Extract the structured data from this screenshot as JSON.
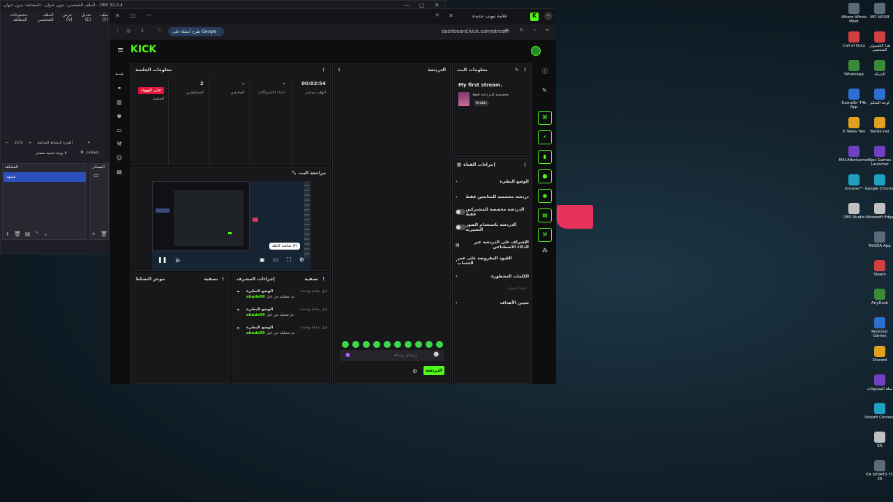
{
  "obs": {
    "title": "OBS 32.0.4 - الملف الشخصي: بدون عنوان - المشاهد: بدون عنوان",
    "menu": [
      "ملف (F)",
      "تعديل (E)",
      "عرض (V)",
      "الملف الشخصي",
      "مجموعات المشاهد"
    ],
    "zoom": "21%",
    "filter_label": "الفترة النشاط السابقة",
    "btn_settings": "إعدادات",
    "btn_transition": "لا يوجد تحديد مصدر",
    "scenes_header": "المشاهد",
    "sources_header": "المصادر",
    "scene_item": "مشهد"
  },
  "browser": {
    "tab1": "علامة تبويب جديدة",
    "url": "dashboard.kick.com/stream",
    "google_label": "طرح أسئلة على Google"
  },
  "kick": {
    "logo": "KICK",
    "session": {
      "title": "معلومات الجلسة",
      "stats": [
        {
          "value": "00:02:54",
          "label": "الوقت مباشر"
        },
        {
          "value": "-",
          "label": "اعداد الاشتراكات"
        },
        {
          "value": "-",
          "label": "المتابعين"
        },
        {
          "value": "2",
          "label": "المشاهدين"
        },
        {
          "value": "",
          "label": "الجلسة"
        }
      ],
      "live_badge": "على الهواء"
    },
    "preview": {
      "title": "مراجعة البث",
      "tooltip": "شاشة كاملة (f)"
    },
    "chat": {
      "title": "الدردشة",
      "placeholder": "إرسال رسالة",
      "send": "الدردشة"
    },
    "stream_info": {
      "title": "معلومات البث",
      "stream_title": "My first stream.",
      "category": "مخصصة للدردشة فقط",
      "language": "Arabic"
    },
    "channel_actions": {
      "title": "إجراءات القناة",
      "items": [
        "الوضع البطيء",
        "دردشة مخصصة للمتابعين فقط",
        "الدردشة مخصصة للمشتركين فقط",
        "الدردشة باستخدام الصور التعبيرية",
        "الإشراف على الدردشة عبر الذكاء الاصطناعي",
        "القيود المفروضة على عمر الحساب",
        "الكلمات المحظورة"
      ],
      "section": "قناة التسلية",
      "goals": "تعيين الأهداف"
    },
    "activity": {
      "title": "موجز النشاط",
      "filter": "تصفية"
    },
    "mod_actions": {
      "title": "إجراءات المشرف",
      "filter": "تصفية",
      "entries": [
        {
          "action": "الوضع البطيء",
          "detail": "تم تعطيله من قبل",
          "user": "abade99",
          "time": "قبل ساعة واحدة"
        },
        {
          "action": "الوضع البطيء",
          "detail": "تم تفعيله من قبل",
          "user": "abade99",
          "time": "قبل ساعة واحدة"
        },
        {
          "action": "الوضع البطيء",
          "detail": "تم تعطيله من قبل",
          "user": "abade99",
          "time": "قبل ساعة واحدة"
        }
      ]
    }
  },
  "desktop": {
    "col1": [
      "Where Winds Meet",
      "Call of Duty",
      "WhatsApp",
      "GameSir T4k App",
      "It Takes Two",
      "MSI Afterburner",
      "Unravel™",
      "OBS Studio"
    ],
    "col2": [
      "MO NOOR",
      "هذا الكمبيوتر الشخصي",
      "الشبكة",
      "لوحة التحكم",
      "Battle.net",
      "Epic Games Launcher",
      "Google Chrome",
      "Microsoft Edge",
      "NVIDIA App",
      "Steam",
      "AnyDesk",
      "Rockstar Games",
      "Discord",
      "سلة المحذوفات",
      "Ubisoft Connect",
      "EA",
      "EA SPORTS FC 26"
    ]
  },
  "colors": {
    "accent": "#53fc18",
    "live": "#e3173a",
    "pink": "#e6335b"
  }
}
